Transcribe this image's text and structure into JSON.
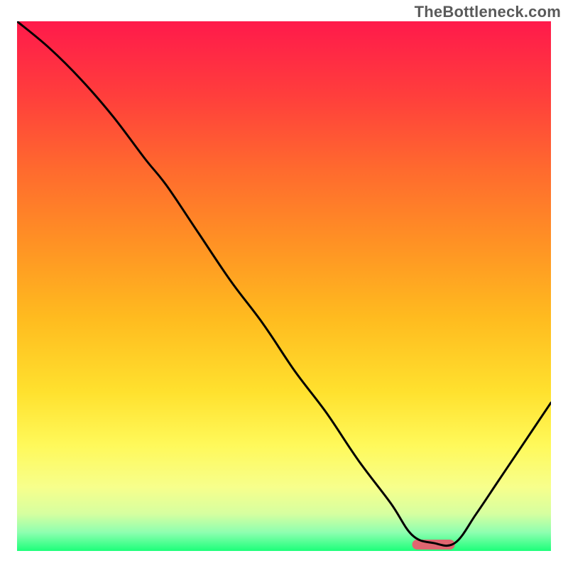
{
  "watermark": "TheBottleneck.com",
  "chart_data": {
    "type": "line",
    "title": "",
    "xlabel": "",
    "ylabel": "",
    "xlim": [
      0,
      100
    ],
    "ylim": [
      0,
      100
    ],
    "grid": false,
    "legend": false,
    "marker": {
      "x_start": 74,
      "x_end": 82,
      "y": 1.2
    },
    "series": [
      {
        "name": "curve",
        "x": [
          0,
          6,
          12,
          18,
          24,
          28,
          34,
          40,
          46,
          52,
          58,
          64,
          70,
          74,
          78,
          82,
          86,
          90,
          94,
          100
        ],
        "y": [
          100,
          95,
          89,
          82,
          74,
          69,
          60,
          51,
          43,
          34,
          26,
          17,
          9,
          3,
          1.5,
          1.5,
          7,
          13,
          19,
          28
        ]
      }
    ],
    "gradient_stops": [
      {
        "offset": 0.0,
        "color": "#ff1a4b"
      },
      {
        "offset": 0.14,
        "color": "#ff3e3c"
      },
      {
        "offset": 0.28,
        "color": "#ff6a2e"
      },
      {
        "offset": 0.42,
        "color": "#ff9224"
      },
      {
        "offset": 0.56,
        "color": "#ffbb1f"
      },
      {
        "offset": 0.7,
        "color": "#ffe12e"
      },
      {
        "offset": 0.8,
        "color": "#fff95a"
      },
      {
        "offset": 0.88,
        "color": "#f7ff8c"
      },
      {
        "offset": 0.93,
        "color": "#d6ffa0"
      },
      {
        "offset": 0.965,
        "color": "#8effb0"
      },
      {
        "offset": 1.0,
        "color": "#1dff7a"
      }
    ],
    "marker_color": "#e06670",
    "curve_color": "#000000"
  }
}
